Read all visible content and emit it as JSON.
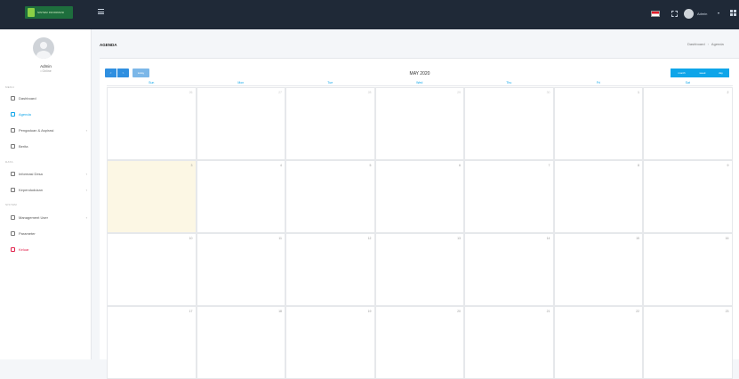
{
  "topbar": {
    "logo_text": "SISTEM INFORMASI",
    "user_name": "Admin",
    "flag_label": "ID",
    "colors": {
      "bg": "#1f2937",
      "logo": "#1e6e3d"
    }
  },
  "sidebar": {
    "profile": {
      "name": "Admin",
      "status": "• Online"
    },
    "sections": [
      {
        "label": "MENU",
        "items": [
          {
            "label": "Dashboard",
            "icon": "home-icon"
          },
          {
            "label": "Agenda",
            "icon": "calendar-icon",
            "active": true
          },
          {
            "label": "Pengaduan & Aspirasi",
            "icon": "message-icon",
            "has_children": true
          },
          {
            "label": "Berita",
            "icon": "news-icon"
          }
        ]
      },
      {
        "label": "DATA",
        "items": [
          {
            "label": "Informasi Desa",
            "icon": "info-icon",
            "has_children": true
          },
          {
            "label": "Kependudukan",
            "icon": "users-icon",
            "has_children": true
          }
        ]
      },
      {
        "label": "SISTEM",
        "items": [
          {
            "label": "Management User",
            "icon": "user-cog-icon",
            "has_children": true
          },
          {
            "label": "Parameter",
            "icon": "settings-icon"
          },
          {
            "label": "Keluar",
            "icon": "logout-icon",
            "logout": true
          }
        ]
      }
    ]
  },
  "content": {
    "page_title": "AGENDA",
    "breadcrumb": [
      "Dashboard",
      "Agenda"
    ]
  },
  "calendar": {
    "title": "MAY 2020",
    "prev_label": "<",
    "next_label": ">",
    "today_label": "today",
    "view_buttons": [
      "month",
      "week",
      "day"
    ],
    "weekdays": [
      "Sun",
      "Mon",
      "Tue",
      "Wed",
      "Thu",
      "Fri",
      "Sat"
    ],
    "weeks": [
      [
        {
          "d": "26",
          "m": true
        },
        {
          "d": "27",
          "m": true
        },
        {
          "d": "28",
          "m": true
        },
        {
          "d": "29",
          "m": true
        },
        {
          "d": "30",
          "m": true
        },
        {
          "d": "1"
        },
        {
          "d": "2"
        }
      ],
      [
        {
          "d": "3",
          "today": true
        },
        {
          "d": "4"
        },
        {
          "d": "5"
        },
        {
          "d": "6"
        },
        {
          "d": "7"
        },
        {
          "d": "8"
        },
        {
          "d": "9"
        }
      ],
      [
        {
          "d": "10"
        },
        {
          "d": "11"
        },
        {
          "d": "12"
        },
        {
          "d": "13"
        },
        {
          "d": "14"
        },
        {
          "d": "15"
        },
        {
          "d": "16"
        }
      ],
      [
        {
          "d": "17"
        },
        {
          "d": "18"
        },
        {
          "d": "19"
        },
        {
          "d": "20"
        },
        {
          "d": "21"
        },
        {
          "d": "22"
        },
        {
          "d": "23"
        }
      ]
    ],
    "colors": {
      "accent": "#0ea5e9",
      "today_bg": "#fcf7e4",
      "nav_btn": "#2f8fe0"
    }
  }
}
